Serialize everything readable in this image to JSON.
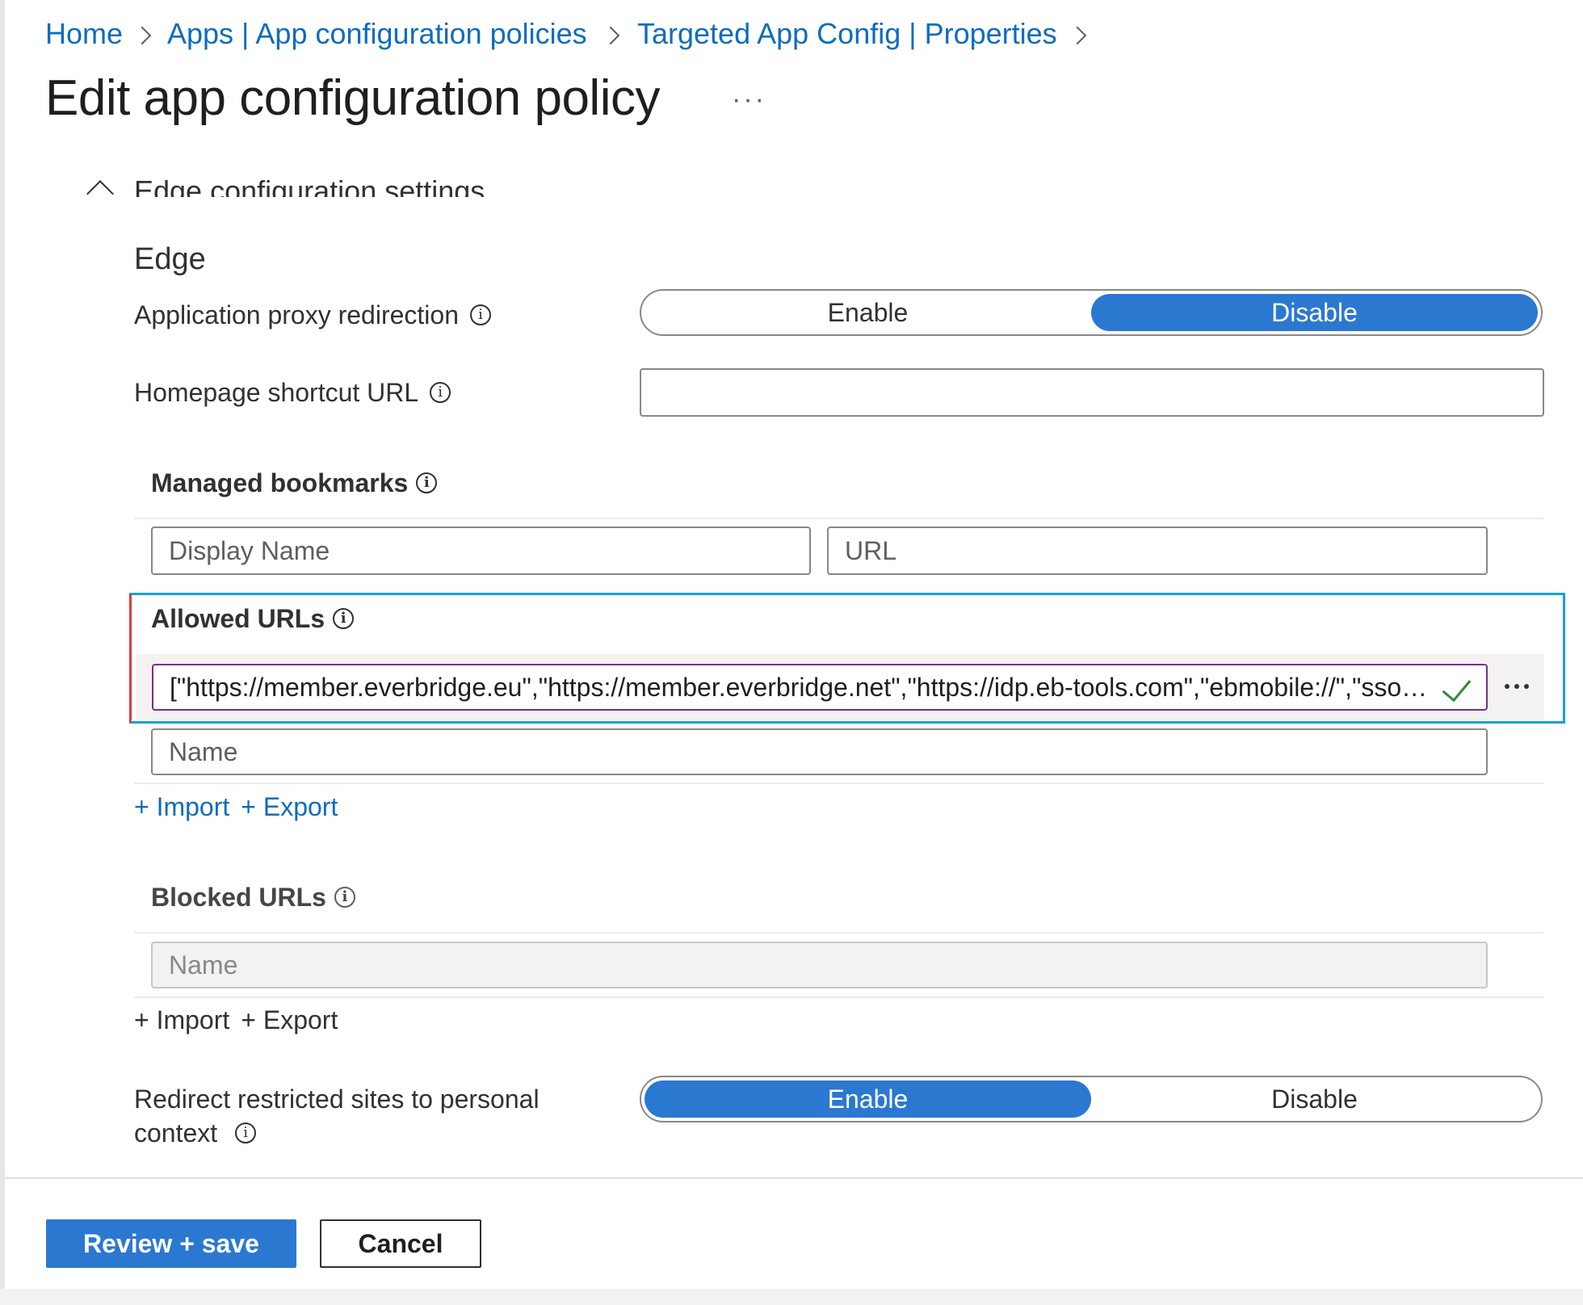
{
  "breadcrumb": {
    "items": [
      "Home",
      "Apps | App configuration policies",
      "Targeted App Config | Properties"
    ]
  },
  "page": {
    "title": "Edit app configuration policy",
    "more": "···"
  },
  "section": {
    "title": "Edge configuration settings",
    "subhead": "Edge"
  },
  "app_proxy": {
    "label": "Application proxy redirection",
    "options": [
      "Enable",
      "Disable"
    ],
    "selected": "Disable"
  },
  "homepage": {
    "label": "Homepage shortcut URL",
    "value": ""
  },
  "managed_bookmarks": {
    "label": "Managed bookmarks",
    "display_name_placeholder": "Display Name",
    "url_placeholder": "URL"
  },
  "allowed_urls": {
    "label": "Allowed URLs",
    "value": "[\"https://member.everbridge.eu\",\"https://member.everbridge.net\",\"https://idp.eb-tools.com\",\"ebmobile://\",\"sso…",
    "name_placeholder": "Name",
    "import": "+ Import",
    "export": "+ Export"
  },
  "blocked_urls": {
    "label": "Blocked URLs",
    "name_placeholder": "Name",
    "import": "+ Import",
    "export": "+ Export"
  },
  "redirect": {
    "label_line1": "Redirect restricted sites to personal",
    "label_line2": "context",
    "options": [
      "Enable",
      "Disable"
    ],
    "selected": "Enable"
  },
  "footer": {
    "review_save": "Review + save",
    "cancel": "Cancel"
  },
  "colors": {
    "accent": "#2b78d1",
    "link": "#0f6cbd",
    "highlight": "#1a9fe0"
  }
}
